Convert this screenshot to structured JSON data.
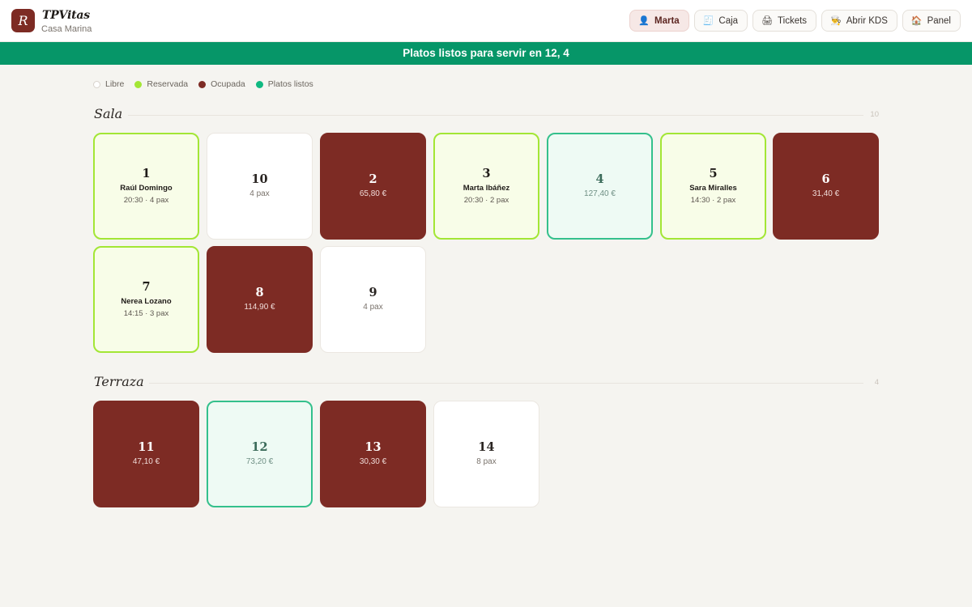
{
  "header": {
    "logo_letter": "R",
    "title": "TPVitas",
    "subtitle": "Casa Marina",
    "nav": [
      {
        "icon": "👤",
        "icon_name": "user-icon",
        "label": "Marta",
        "active": true
      },
      {
        "icon": "🧾",
        "icon_name": "receipt-icon",
        "label": "Caja"
      },
      {
        "icon": "🖨",
        "icon_name": "printer-icon",
        "label": "Tickets"
      },
      {
        "icon": "👨‍🍳",
        "icon_name": "chef-icon",
        "label": "Abrir KDS"
      },
      {
        "icon": "🏠",
        "icon_name": "home-icon",
        "label": "Panel"
      }
    ]
  },
  "banner": {
    "text": "Platos listos para servir en 12, 4"
  },
  "legend": [
    {
      "label": "Libre",
      "status": "libre"
    },
    {
      "label": "Reservada",
      "status": "reservada"
    },
    {
      "label": "Ocupada",
      "status": "ocupada"
    },
    {
      "label": "Platos listos",
      "status": "listos"
    }
  ],
  "colors": {
    "accent": "#7d2b24",
    "banner": "#069668",
    "reserved": "#a3e635",
    "ready": "#10b981",
    "background": "#f5f4f0"
  },
  "sections": [
    {
      "name": "Sala",
      "count": "10",
      "tables": [
        {
          "number": "1",
          "status": "reservada",
          "name": "Raúl Domingo",
          "info": "20:30 · 4 pax"
        },
        {
          "number": "10",
          "status": "libre",
          "value": "4 pax"
        },
        {
          "number": "2",
          "status": "ocupada",
          "value": "65,80 €"
        },
        {
          "number": "3",
          "status": "reservada",
          "name": "Marta Ibáñez",
          "info": "20:30 · 2 pax"
        },
        {
          "number": "4",
          "status": "listos",
          "value": "127,40 €"
        },
        {
          "number": "5",
          "status": "reservada",
          "name": "Sara Miralles",
          "info": "14:30 · 2 pax"
        },
        {
          "number": "6",
          "status": "ocupada",
          "value": "31,40 €"
        },
        {
          "number": "7",
          "status": "reservada",
          "name": "Nerea Lozano",
          "info": "14:15 · 3 pax"
        },
        {
          "number": "8",
          "status": "ocupada",
          "value": "114,90 €"
        },
        {
          "number": "9",
          "status": "libre",
          "value": "4 pax"
        }
      ]
    },
    {
      "name": "Terraza",
      "count": "4",
      "tables": [
        {
          "number": "11",
          "status": "ocupada",
          "value": "47,10 €"
        },
        {
          "number": "12",
          "status": "listos",
          "value": "73,20 €"
        },
        {
          "number": "13",
          "status": "ocupada",
          "value": "30,30 €"
        },
        {
          "number": "14",
          "status": "libre",
          "value": "8 pax"
        }
      ]
    }
  ]
}
